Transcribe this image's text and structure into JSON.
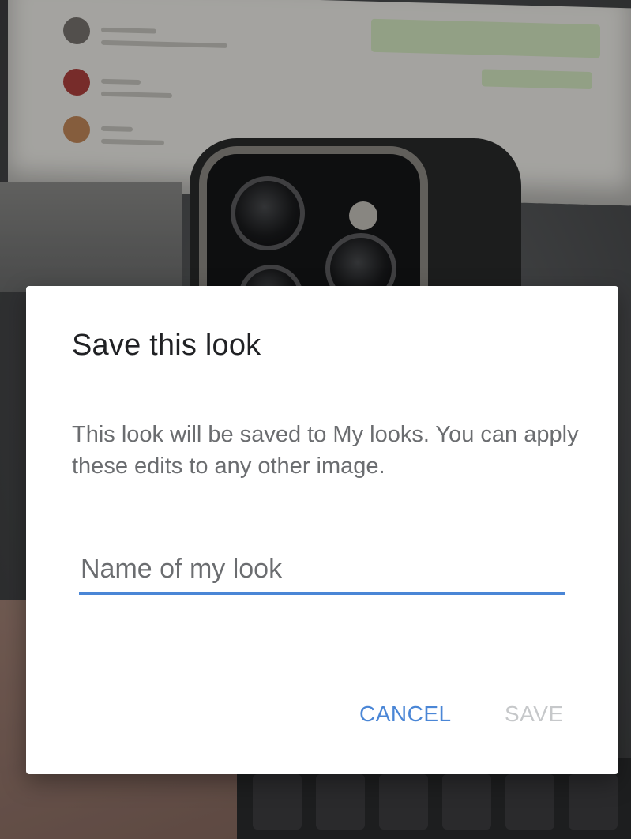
{
  "dialog": {
    "title": "Save this look",
    "message": "This look will be saved to My looks. You can apply these edits to any other image.",
    "name_input": {
      "value": "",
      "placeholder": "Name of my look"
    },
    "buttons": {
      "cancel_label": "CANCEL",
      "save_label": "SAVE",
      "save_enabled": false
    }
  },
  "colors": {
    "accent": "#4a86d6",
    "title_text": "#202124",
    "body_text": "#6b6d70",
    "disabled_text": "#c6c8ca",
    "scrim": "rgba(0,0,0,0.32)"
  }
}
